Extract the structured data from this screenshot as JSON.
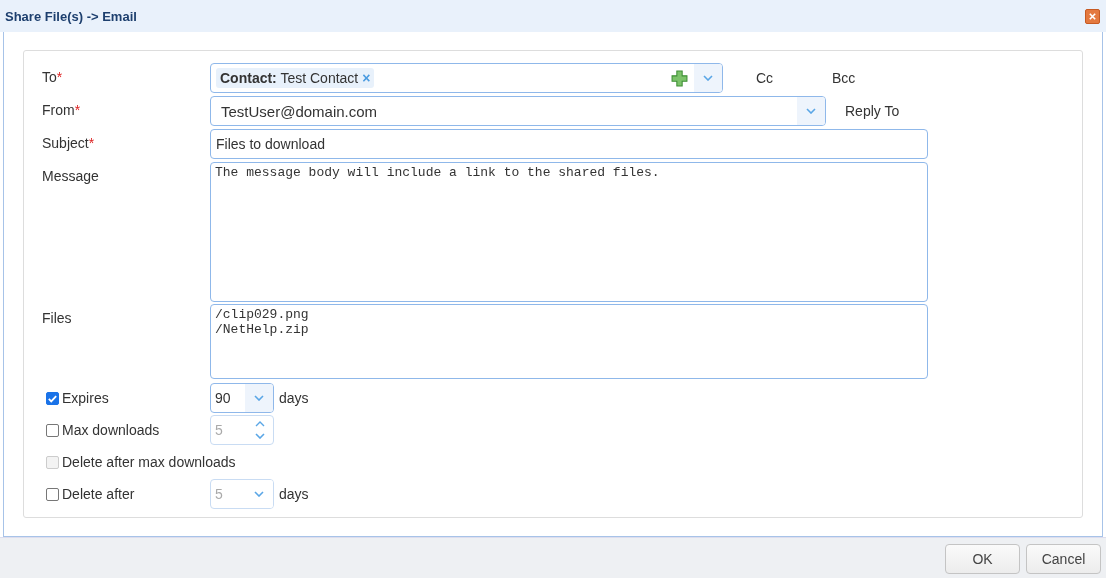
{
  "window": {
    "title": "Share File(s) -> Email"
  },
  "to": {
    "label": "To",
    "required_mark": "*",
    "chips": [
      {
        "prefix": "Contact:",
        "name": "Test Contact",
        "remove": "×"
      }
    ]
  },
  "cc": "Cc",
  "bcc": "Bcc",
  "from": {
    "label": "From",
    "required_mark": "*",
    "value": "TestUser@domain.com"
  },
  "reply_to": "Reply To",
  "subject": {
    "label": "Subject",
    "required_mark": "*",
    "value": "Files to download"
  },
  "message": {
    "label": "Message",
    "value": "The message body will include a link to the shared files."
  },
  "files": {
    "label": "Files",
    "value": "/clip029.png\n/NetHelp.zip"
  },
  "options": [
    {
      "kind": "select",
      "label": "Expires",
      "checked": true,
      "disabled": false,
      "value": "90",
      "unit": "days",
      "input_disabled": false
    },
    {
      "kind": "spinner",
      "label": "Max downloads",
      "checked": false,
      "disabled": false,
      "value": "5",
      "input_disabled": true
    },
    {
      "kind": "plain",
      "label": "Delete after max downloads",
      "checked": false,
      "disabled": true
    },
    {
      "kind": "select",
      "label": "Delete after",
      "checked": false,
      "disabled": false,
      "value": "5",
      "unit": "days",
      "input_disabled": true
    }
  ],
  "buttons": [
    "OK",
    "Cancel"
  ]
}
